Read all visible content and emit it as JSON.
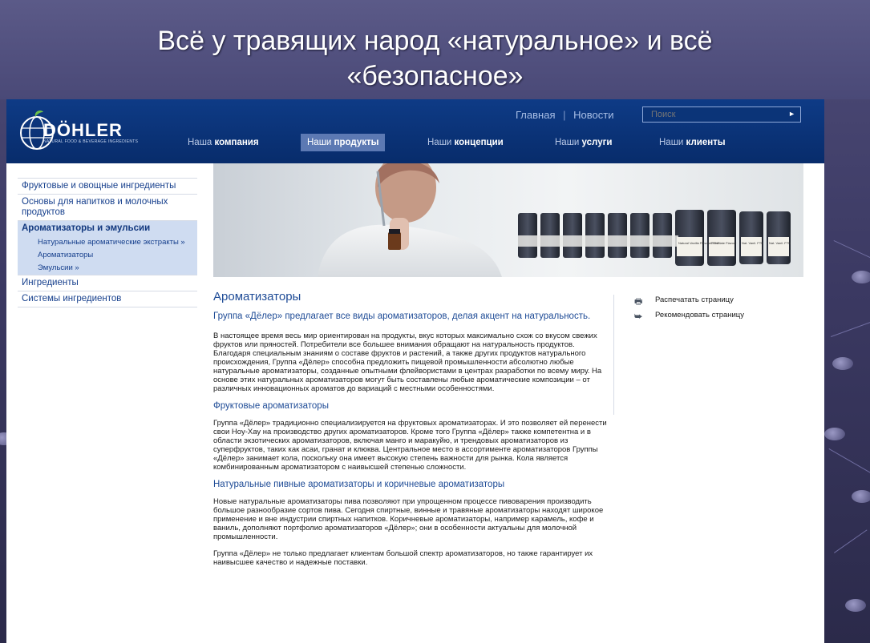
{
  "slide": {
    "title_line1": "Всё у травящих народ «натуральное» и всё",
    "title_line2": "«безопасное»"
  },
  "site": {
    "logo_text": "DÖHLER",
    "logo_tagline": "NATURAL FOOD & BEVERAGE INGREDIENTS",
    "top_links": [
      "Главная",
      "Новости"
    ],
    "top_separator": "|",
    "search_placeholder": "Поиск",
    "search_go": "►",
    "nav": [
      {
        "prefix": "Наша ",
        "bold": "компания"
      },
      {
        "prefix": "Наши ",
        "bold": "продукты"
      },
      {
        "prefix": "Наши ",
        "bold": "концепции"
      },
      {
        "prefix": "Наши ",
        "bold": "услуги"
      },
      {
        "prefix": "Наши ",
        "bold": "клиенты"
      }
    ]
  },
  "leftmenu": {
    "items": [
      "Фруктовые и овощные ингредиенты",
      "Основы для напитков и молочных продуктов",
      "Ароматизаторы и эмульсии",
      "Ингредиенты",
      "Системы ингредиентов"
    ],
    "subitems": [
      "Натуральные ароматические экстракты »",
      "Ароматизаторы",
      "Эмульсии »"
    ]
  },
  "content": {
    "title": "Ароматизаторы",
    "lead": "Группа «Дёлер» предлагает все виды ароматизаторов, делая акцент на натуральность.",
    "p1": "В настоящее время весь мир ориентирован на продукты, вкус которых максимально схож со вкусом свежих фруктов или пряностей. Потребители все большее внимания обращают на натуральность продуктов. Благодаря специальным знаниям о составе фруктов и растений, а также других продуктов натурального происхождения, Группа «Дёлер» способна предложить пищевой промышленности абсолютно любые натуральные ароматизаторы, созданные опытными флейвористами в центрах разработки по всему миру. На основе этих натуральных ароматизаторов могут быть составлены любые ароматические композиции – от различных инновационных ароматов до вариаций с местными особенностями.",
    "h2a": "Фруктовые ароматизаторы",
    "p2": "Группа «Дёлер» традиционно специализируется на фруктовых ароматизаторах. И это позволяет ей перенести свои Ноу-Хау на производство других ароматизаторов. Кроме того Группа «Дёлер» также компетентна и в области экзотических ароматизаторов, включая манго и маракуйю, и трендовых ароматизаторов из суперфруктов, таких как асаи, гранат и клюква. Центральное место в ассортименте ароматизаторов Группы «Дёлер» занимает кола, поскольку она имеет высокую степень важности для рынка. Кола является комбинированным ароматизатором с наивысшей степенью сложности.",
    "h2b": "Натуральные пивные ароматизаторы и коричневые ароматизаторы",
    "p3": "Новые натуральные ароматизаторы пива позволяют при упрощенном процессе пивоварения производить большое разнообразие сортов пива. Сегодня спиртные, винные и травяные ароматизаторы находят широкое применение и вне индустрии спиртных напитков. Коричневые ароматизаторы, например карамель, кофе и ваниль, дополняют портфолио ароматизаторов «Дёлер»; они в особенности актуальны для молочной промышленности.",
    "p4": "Группа «Дёлер» не только предлагает клиентам большой спектр ароматизаторов, но также гарантирует их наивысшее качество и надежные поставки."
  },
  "tools": {
    "print": "Распечатать страницу",
    "recommend": "Рекомендовать страницу"
  },
  "bottle_labels": [
    "Natural Vanilla Flavour FTNF",
    "Chocolate Flavour",
    "Nat. Vanil. FTN",
    "Nat. Vanil. FTN"
  ]
}
